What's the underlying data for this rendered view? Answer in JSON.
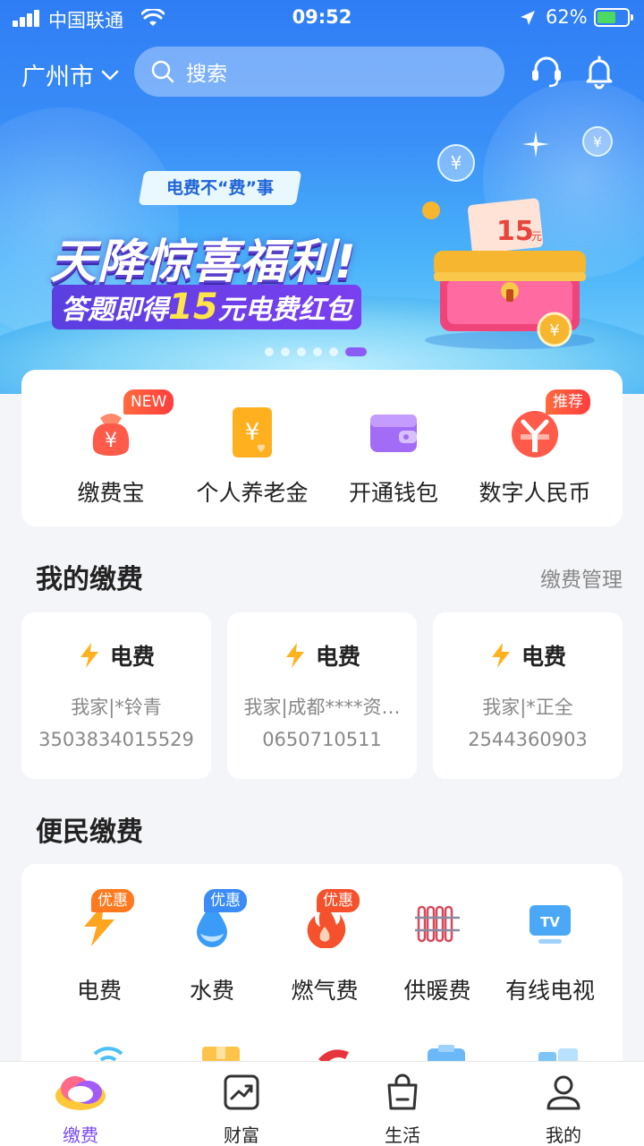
{
  "status_bar": {
    "carrier": "中国联通",
    "time": "09:52",
    "battery": "62%"
  },
  "header": {
    "city": "广州市",
    "search_placeholder": "搜索"
  },
  "banner": {
    "tag": "电费不“费”事",
    "title": "天降惊喜福利!",
    "subtitle_prefix": "答题即得",
    "subtitle_amount": "15",
    "subtitle_suffix": "元电费红包",
    "coupon_value": "15",
    "coupon_unit": "元",
    "page_count": 6,
    "active_page": 6
  },
  "quick_actions": [
    {
      "label": "缴费宝",
      "icon": "money-bag-icon",
      "badge": "NEW"
    },
    {
      "label": "个人养老金",
      "icon": "pension-card-icon",
      "badge": ""
    },
    {
      "label": "开通钱包",
      "icon": "wallet-icon",
      "badge": ""
    },
    {
      "label": "数字人民币",
      "icon": "digital-rmb-icon",
      "badge": "推荐"
    }
  ],
  "my_bills": {
    "title": "我的缴费",
    "manage_link": "缴费管理",
    "items": [
      {
        "type": "电费",
        "name": "我家|*铃青",
        "account": "3503834015529"
      },
      {
        "type": "电费",
        "name": "我家|成都****资…",
        "account": "0650710511"
      },
      {
        "type": "电费",
        "name": "我家|*正全",
        "account": "2544360903"
      }
    ]
  },
  "convenience": {
    "title": "便民缴费",
    "items": [
      {
        "label": "电费",
        "icon": "lightning-icon",
        "badge": "优惠",
        "badge_color": "#ff7a1f"
      },
      {
        "label": "水费",
        "icon": "water-drop-icon",
        "badge": "优惠",
        "badge_color": "#3b8cf7"
      },
      {
        "label": "燃气费",
        "icon": "flame-icon",
        "badge": "优惠",
        "badge_color": "#f4512c"
      },
      {
        "label": "供暖费",
        "icon": "radiator-icon",
        "badge": "",
        "badge_color": ""
      },
      {
        "label": "有线电视",
        "icon": "tv-icon",
        "badge": "",
        "badge_color": ""
      }
    ]
  },
  "tabbar": {
    "items": [
      {
        "label": "缴费",
        "icon": "pay-cloud-icon",
        "active": true
      },
      {
        "label": "财富",
        "icon": "wealth-chart-icon",
        "active": false
      },
      {
        "label": "生活",
        "icon": "shopping-bag-icon",
        "active": false
      },
      {
        "label": "我的",
        "icon": "user-icon",
        "active": false
      }
    ]
  },
  "colors": {
    "accent": "#7a4cf0",
    "hero_blue": "#2f7df5",
    "bolt_orange": "#ffb21f"
  }
}
